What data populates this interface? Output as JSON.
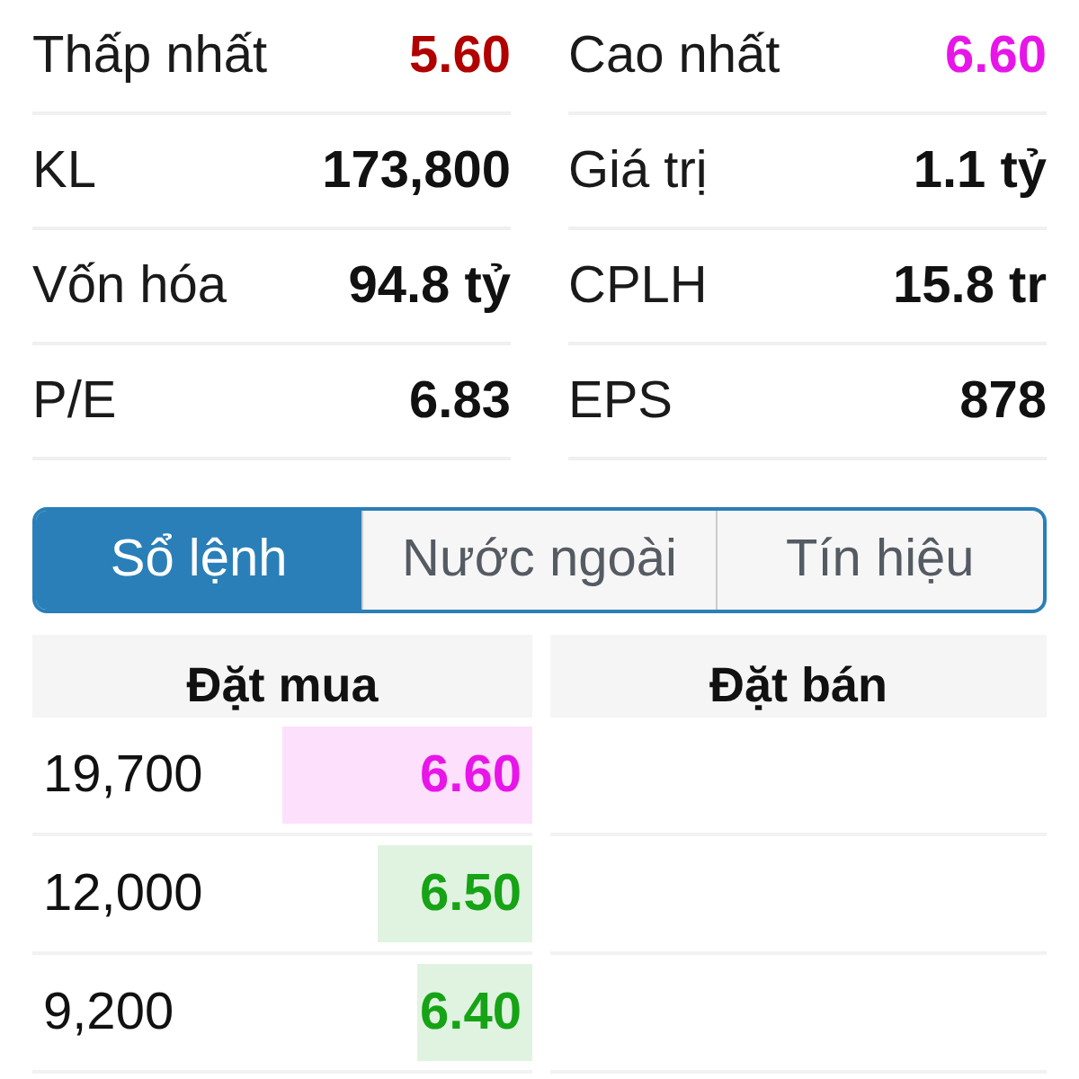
{
  "stats": [
    [
      {
        "label": "Thấp nhất",
        "value": "5.60",
        "color": "#b00000"
      },
      {
        "label": "Cao nhất",
        "value": "6.60",
        "color": "#e815e8"
      }
    ],
    [
      {
        "label": "KL",
        "value": "173,800",
        "color": "#111111"
      },
      {
        "label": "Giá trị",
        "value": "1.1 tỷ",
        "color": "#111111"
      }
    ],
    [
      {
        "label": "Vốn hóa",
        "value": "94.8 tỷ",
        "color": "#111111"
      },
      {
        "label": "CPLH",
        "value": "15.8 tr",
        "color": "#111111"
      }
    ],
    [
      {
        "label": "P/E",
        "value": "6.83",
        "color": "#111111"
      },
      {
        "label": "EPS",
        "value": "878",
        "color": "#111111"
      }
    ]
  ],
  "tabs": [
    {
      "label": "Sổ lệnh",
      "selected": true
    },
    {
      "label": "Nước ngoài",
      "selected": false
    },
    {
      "label": "Tín hiệu",
      "selected": false
    }
  ],
  "order_book": {
    "columns": [
      "Đặt mua",
      "Đặt bán"
    ],
    "bids": [
      {
        "volume": "19,700",
        "price": "6.60",
        "color": "#e815e8",
        "level": 0.5
      },
      {
        "volume": "12,000",
        "price": "6.50",
        "color": "#16a316",
        "level": 0.31
      },
      {
        "volume": "9,200",
        "price": "6.40",
        "color": "#16a316",
        "level": 0.23
      }
    ]
  }
}
